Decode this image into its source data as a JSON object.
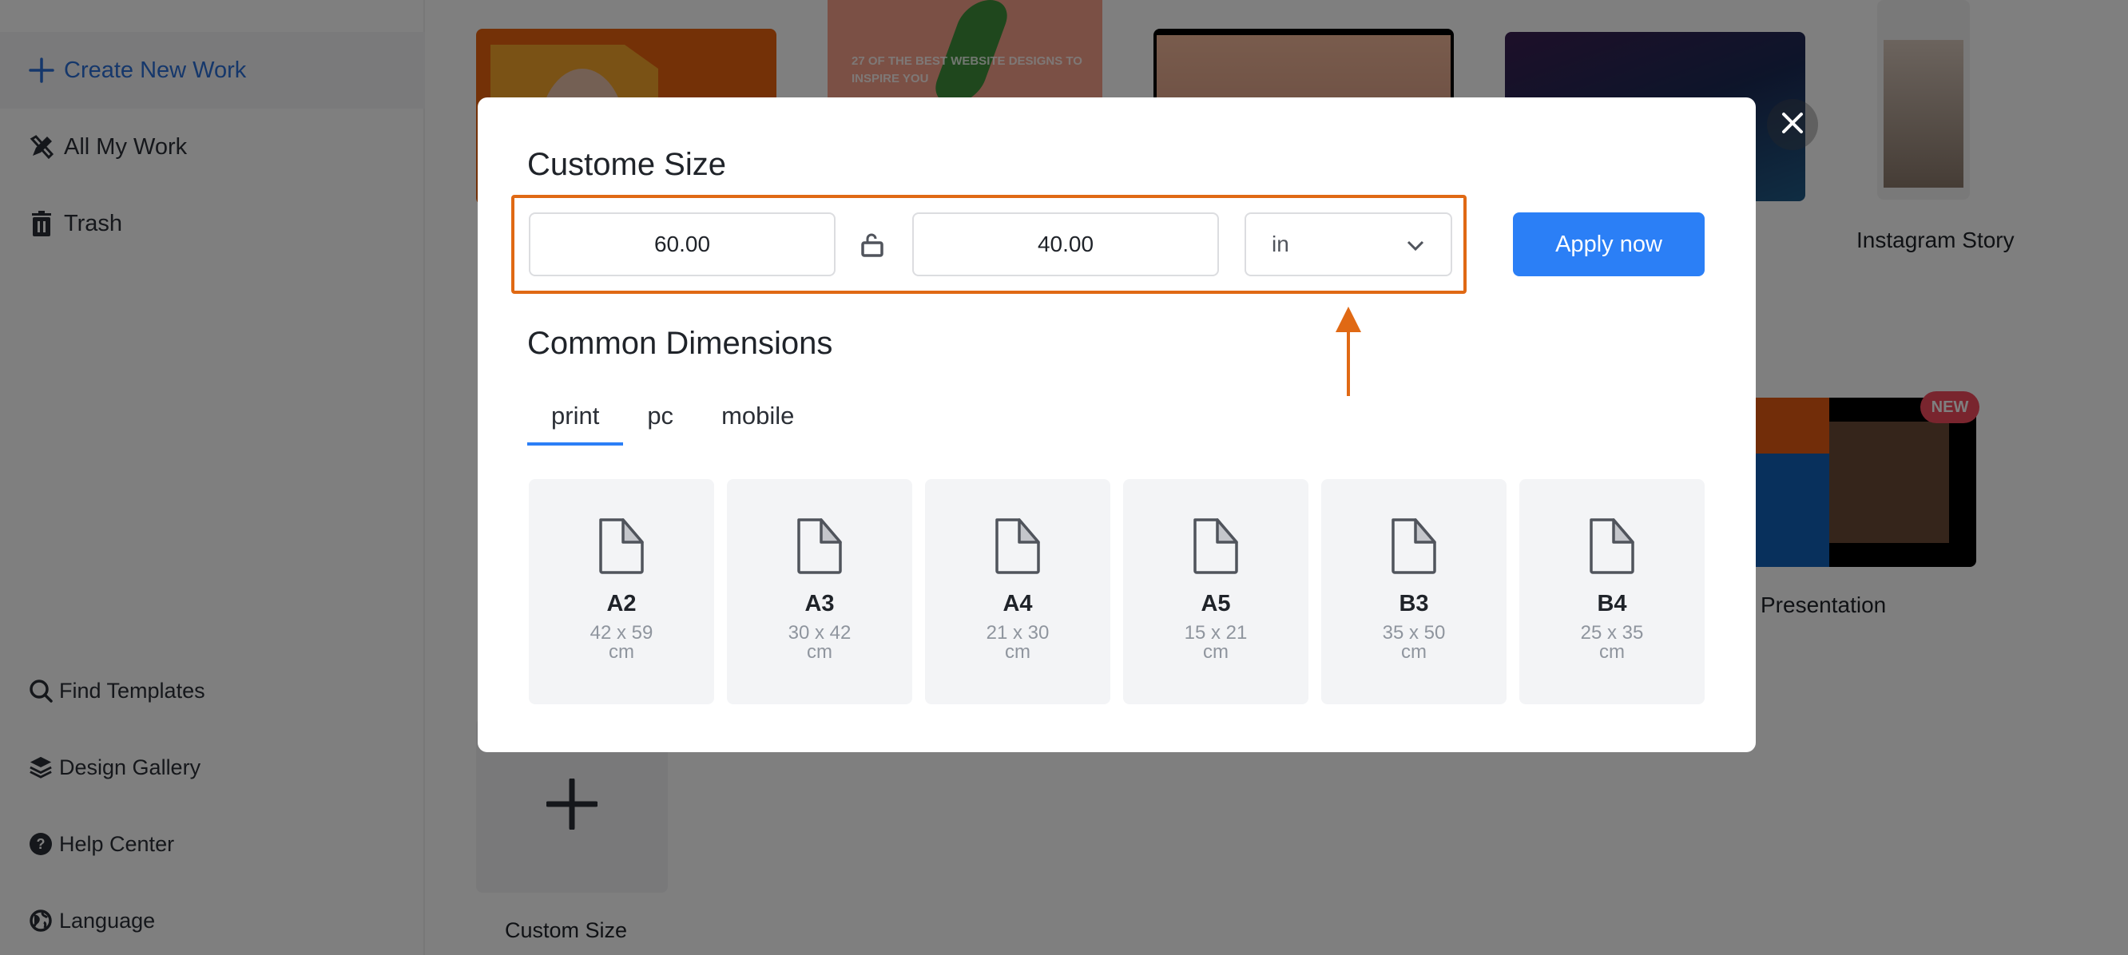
{
  "sidebar": {
    "top_items": [
      {
        "label": "Create New Work",
        "icon": "plus-icon",
        "active": true
      },
      {
        "label": "All My Work",
        "icon": "pencil-ruler-icon"
      },
      {
        "label": "Trash",
        "icon": "trash-icon"
      }
    ],
    "bottom_items": [
      {
        "label": "Find Templates",
        "icon": "search-icon"
      },
      {
        "label": "Design Gallery",
        "icon": "layers-icon"
      },
      {
        "label": "Help Center",
        "icon": "help-circle-icon"
      },
      {
        "label": "Language",
        "icon": "globe-icon"
      }
    ]
  },
  "background": {
    "thumb_text": "27 OF THE BEST WEBSITE DESIGNS TO INSPIRE YOU",
    "labels": {
      "instagram_story": "Instagram Story",
      "presentation": "Presentation",
      "custom_size": "Custom Size"
    },
    "badge": "NEW"
  },
  "modal": {
    "title": "Custome Size",
    "width_value": "60.00",
    "height_value": "40.00",
    "unit": "in",
    "apply_label": "Apply now",
    "common_title": "Common Dimensions",
    "tabs": [
      {
        "label": "print",
        "active": true
      },
      {
        "label": "pc"
      },
      {
        "label": "mobile"
      }
    ],
    "presets": [
      {
        "name": "A2",
        "size": "42 x 59",
        "unit": "cm"
      },
      {
        "name": "A3",
        "size": "30 x 42",
        "unit": "cm"
      },
      {
        "name": "A4",
        "size": "21 x 30",
        "unit": "cm"
      },
      {
        "name": "A5",
        "size": "15 x 21",
        "unit": "cm"
      },
      {
        "name": "B3",
        "size": "35 x 50",
        "unit": "cm"
      },
      {
        "name": "B4",
        "size": "25 x 35",
        "unit": "cm"
      }
    ],
    "colors": {
      "accent": "#2b7ff6",
      "highlight": "#e06914"
    }
  }
}
